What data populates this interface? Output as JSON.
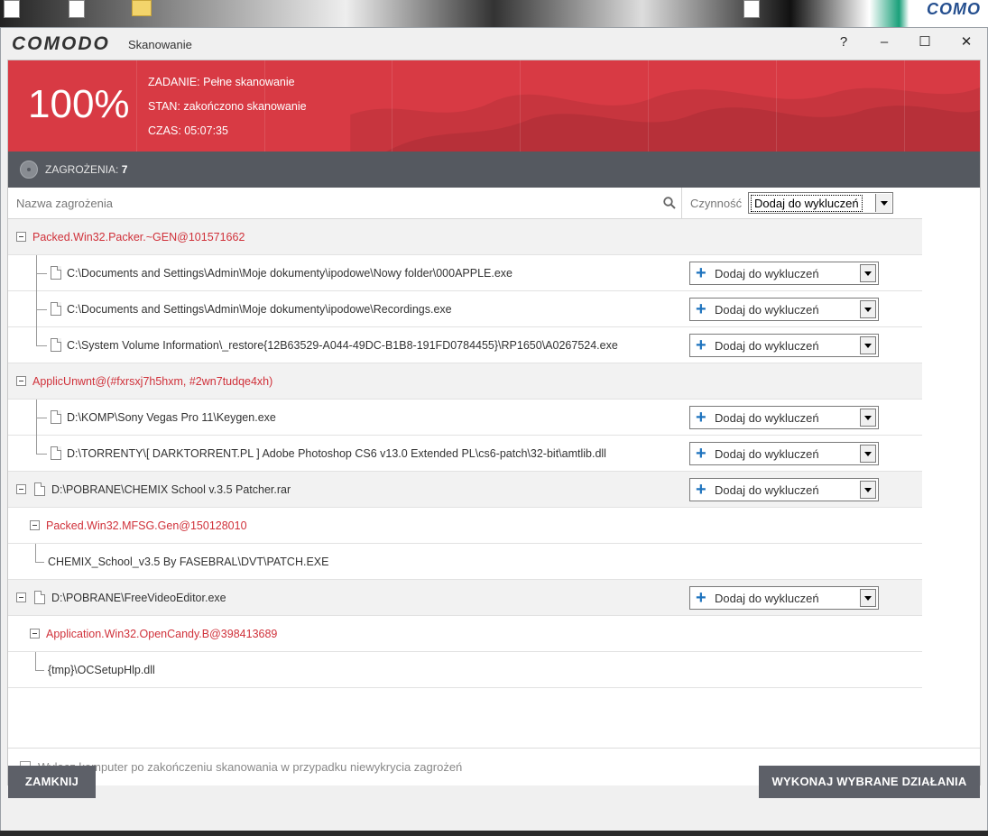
{
  "window": {
    "logo": "COMODO",
    "title": "Skanowanie",
    "help": "?",
    "minimize": "–",
    "maximize": "☐",
    "close": "✕"
  },
  "desktop": {
    "corner_text": "COMO"
  },
  "scan": {
    "percent": "100%",
    "task": "ZADANIE: Pełne skanowanie",
    "status": "STAN: zakończono skanowanie",
    "time": "CZAS: 05:07:35"
  },
  "threats": {
    "label": "ZAGROŻENIA:",
    "count": "7"
  },
  "table": {
    "name_header": "Nazwa zagrożenia",
    "action_header": "Czynność",
    "global_action": "Dodaj do wykluczeń",
    "action_label": "Dodaj do wykluczeń"
  },
  "rows": [
    {
      "kind": "group",
      "text": "Packed.Win32.Packer.~GEN@101571662"
    },
    {
      "kind": "file",
      "text": "C:\\Documents and Settings\\Admin\\Moje dokumenty\\ipodowe\\Nowy folder\\000APPLE.exe"
    },
    {
      "kind": "file",
      "text": "C:\\Documents and Settings\\Admin\\Moje dokumenty\\ipodowe\\Recordings.exe"
    },
    {
      "kind": "file-last",
      "text": "C:\\System Volume Information\\_restore{12B63529-A044-49DC-B1B8-191FD0784455}\\RP1650\\A0267524.exe"
    },
    {
      "kind": "group",
      "text": "ApplicUnwnt@(#fxrsxj7h5hxm, #2wn7tudqe4xh)"
    },
    {
      "kind": "file",
      "text": "D:\\KOMP\\Sony Vegas Pro 11\\Keygen.exe"
    },
    {
      "kind": "file-last",
      "text": "D:\\TORRENTY\\[ DARKTORRENT.PL ] Adobe Photoshop CS6 v13.0 Extended PL\\cs6-patch\\32-bit\\amtlib.dll"
    },
    {
      "kind": "archive",
      "text": "D:\\POBRANE\\CHEMIX School v.3.5 Patcher.rar"
    },
    {
      "kind": "subgroup",
      "text": "Packed.Win32.MFSG.Gen@150128010"
    },
    {
      "kind": "inner",
      "text": "CHEMIX_School_v3.5 By FASEBRAL\\DVT\\PATCH.EXE"
    },
    {
      "kind": "archive",
      "text": "D:\\POBRANE\\FreeVideoEditor.exe"
    },
    {
      "kind": "subgroup",
      "text": "Application.Win32.OpenCandy.B@398413689"
    },
    {
      "kind": "inner",
      "text": "{tmp}\\OCSetupHlp.dll"
    }
  ],
  "footer": {
    "shutdown_label": "Wyłącz komputer po zakończeniu skanowania w przypadku niewykrycia zagrożeń",
    "close_button": "ZAMKNIJ",
    "run_button": "WYKONAJ WYBRANE DZIAŁANIA"
  },
  "colors": {
    "banner": "#d83a44",
    "threat_text": "#d0313a",
    "bar": "#555960",
    "accent": "#1e73be"
  }
}
